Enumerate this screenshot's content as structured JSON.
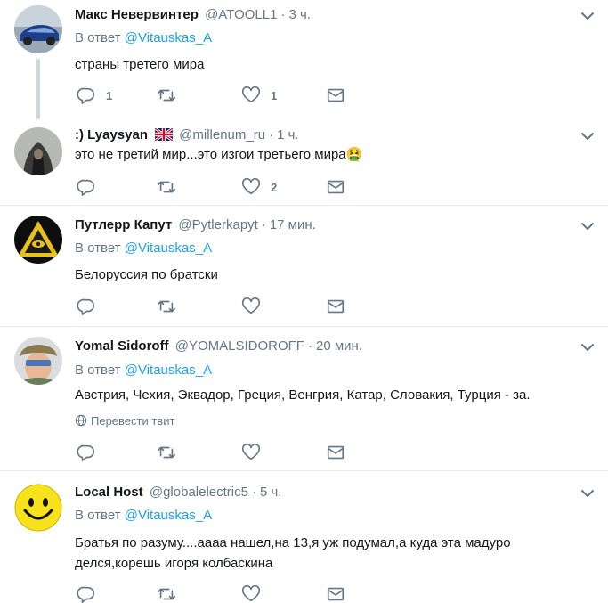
{
  "tweets": [
    {
      "name": "Макс Невервинтер",
      "handle": "@ATOOLL1",
      "time": "3 ч.",
      "reply_prefix": "В ответ",
      "reply_to": "@Vitauskas_A",
      "text": "страны третего мира",
      "reply_count": "1",
      "retweet_count": "",
      "like_count": "1"
    },
    {
      "name": ":) Lyaysyan",
      "handle": "@millenum_ru",
      "time": "1 ч.",
      "text": "это не третий мир...это изгои третьего мира🤮",
      "reply_count": "",
      "retweet_count": "",
      "like_count": "2"
    },
    {
      "name": "Путлерр Капут",
      "handle": "@Pytlerkapyt",
      "time": "17 мин.",
      "reply_prefix": "В ответ",
      "reply_to": "@Vitauskas_A",
      "text": "Белоруссия по братски",
      "reply_count": "",
      "retweet_count": "",
      "like_count": ""
    },
    {
      "name": "Yomal Sidoroff",
      "handle": "@YOMALSIDOROFF",
      "time": "20 мин.",
      "reply_prefix": "В ответ",
      "reply_to": "@Vitauskas_A",
      "text": "Австрия, Чехия, Эквадор, Греция, Венгрия, Катар, Словакия, Турция - за.",
      "translate": "Перевести твит",
      "reply_count": "",
      "retweet_count": "",
      "like_count": ""
    },
    {
      "name": "Local Host",
      "handle": "@globalelectric5",
      "time": "5 ч.",
      "reply_prefix": "В ответ",
      "reply_to": "@Vitauskas_A",
      "text": "Братья по разуму....аааа нашел,на 13,я уж подумал,а куда эта мадуро делся,корешь игоря колбаскина",
      "reply_count": "",
      "retweet_count": "",
      "like_count": ""
    }
  ],
  "icons": {
    "reply": "reply-icon",
    "retweet": "retweet-icon",
    "like": "heart-icon",
    "dm": "envelope-icon",
    "more": "chevron-down-icon",
    "translate": "globe-icon"
  },
  "colors": {
    "link": "#1da1f2",
    "muted": "#657786",
    "text": "#14171a",
    "separator": "#e6ecf0"
  }
}
